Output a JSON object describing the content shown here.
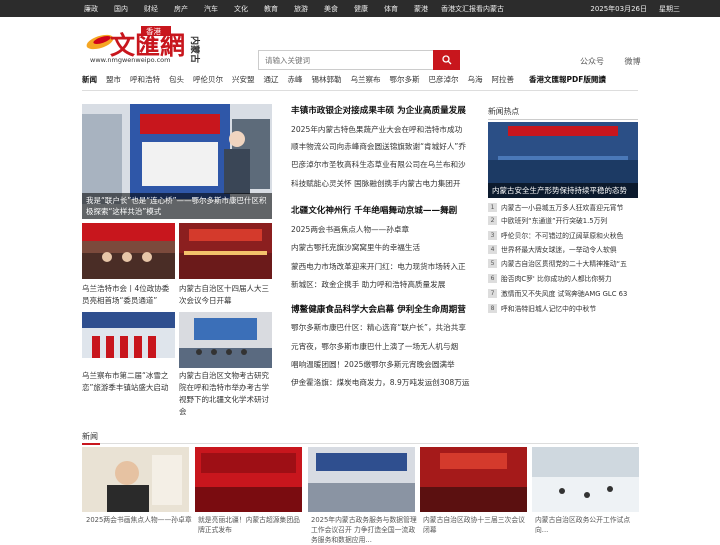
{
  "topbar": {
    "links": [
      "廉政",
      "国内",
      "财经",
      "房产",
      "汽车",
      "文化",
      "教育",
      "旅游",
      "美食",
      "健康",
      "体育",
      "蒙港",
      "香港文汇报看内蒙古"
    ],
    "date": "2025年03月26日",
    "weekday": "星期三"
  },
  "logo": {
    "name": "文匯網",
    "region": "内蒙古",
    "hk": "香港",
    "url": "www.nmgwenweipo.com"
  },
  "search": {
    "placeholder": "请输入关键词"
  },
  "header_links": [
    "公众号",
    "微博"
  ],
  "nav": {
    "items": [
      "新闻",
      "盟市",
      "呼和浩特",
      "包头",
      "呼伦贝尔",
      "兴安盟",
      "通辽",
      "赤峰",
      "锡林郭勒",
      "乌兰察布",
      "鄂尔多斯",
      "巴彦淖尔",
      "乌海",
      "阿拉善"
    ],
    "pdf": "香港文匯報PDF版閱讀"
  },
  "feature": {
    "caption": "我是“联户长”也是“连心桥”——鄂尔多斯市康巴什区积极探索“这样共治”模式"
  },
  "thumbs": [
    {
      "caption": "乌兰浩特市会丨4位政协委员亮相首场“委员通道”"
    },
    {
      "caption": "内蒙古自治区十四届人大三次会议今日开幕"
    },
    {
      "caption": "乌兰察布市第二届“冰雪之恋”旅游季丰镇站盛大启动"
    },
    {
      "caption": "内蒙古自治区文物考古研究院在呼和浩特市举办考古学视野下的北疆文化学术研讨会"
    }
  ],
  "news_groups": [
    {
      "headline": "丰镇市政银企对接成果丰硕 为企业高质量发展",
      "items": [
        "2025年内蒙古特色果蔬产业大会在呼和浩特市成功",
        "顺丰物流公司向赤峰商会圆送锦旗致谢“肯城好人”乔",
        "巴彦淖尔市圣牧高科生态草业有限公司在乌兰布和沙",
        "科技赋能心灵关怀 国脉融创携手内蒙古电力集团开"
      ]
    },
    {
      "headline": "北疆文化神州行 千年绝唱舞动京城——舞剧",
      "items": [
        "2025两会书画焦点人物——孙卓章",
        "内蒙古鄂托克旗沙窝窝里牛的幸福生活",
        "蒙西电力市场改革迎来开门红：电力现货市场转入正",
        "新城区：政金企携手 助力呼和浩特高质量发展"
      ]
    },
    {
      "headline": "博鳌健康食品科学大会启幕 伊利全生命周期营",
      "items": [
        "鄂尔多斯市康巴什区：精心选育“联户长”，共治共享",
        "元宵夜，鄂尔多斯市康巴什上演了一场无人机与烟",
        "唱响温暖团圆！2025缴鄂尔多斯元宵晚会圆满举",
        "伊金霍洛旗：煤炭电商发力，8.9万吨发运创308万运"
      ]
    }
  ],
  "hot": {
    "title": "新闻热点",
    "image_caption": "内蒙古安全生产形势保持持续平稳的态势",
    "items": [
      "内蒙古一小县城五万多人狂欢喜迎元宵节",
      "中欧班列“东通道”开行突破1.5万列",
      "呼伦贝尔：不可错过的辽阔草原和火秋色",
      "世界杯最大牌女球迷，一举动令人软俱",
      "内蒙古自治区贯彻党的二十大精神推动“五",
      "胎否肉C罗' 比你成功的人都比你努力",
      "激情而又不失风度 试驾奔驰AMG GLC 63",
      "呼和浩特旧城人记忆中的中秋节"
    ]
  },
  "section": {
    "title": "新闻"
  },
  "bottom": [
    {
      "caption": "2025两会书画焦点人物——孙卓章"
    },
    {
      "caption": "就是亮丽北疆！内蒙古超源集团品牌正式发布"
    },
    {
      "caption": "2025年内蒙古政务服务与数据管理工作会议召开 力争打造全国一流政务服务和数据应用..."
    },
    {
      "caption": "内蒙古自治区政协十三届三次会议闭幕"
    },
    {
      "caption": "内蒙古自治区政务公开工作试点向..."
    }
  ],
  "colors": {
    "brand": "#c8161d",
    "topbar": "#2c2c2c"
  }
}
